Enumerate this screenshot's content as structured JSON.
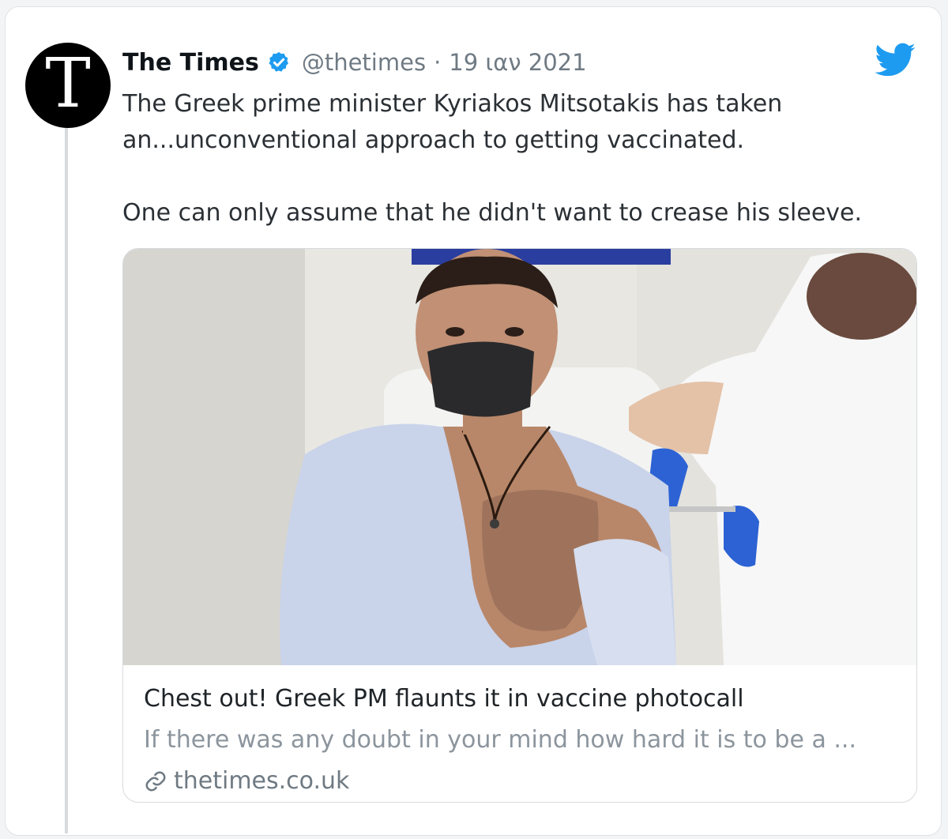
{
  "tweet": {
    "avatar_letter": "T",
    "author_name": "The Times",
    "verified_icon": "verified-badge-icon",
    "handle": "@thetimes",
    "separator": "·",
    "date": "19 ιαν 2021",
    "brand_icon": "twitter-bird-icon",
    "text_lines": [
      "The Greek prime minister Kyriakos Mitsotakis has taken",
      "an...unconventional approach to getting vaccinated.",
      "One can only assume that he didn't want to crease his sleeve."
    ]
  },
  "link_card": {
    "title": "Chest out! Greek PM flaunts it in vaccine photocall",
    "description": "If there was any doubt in your mind how hard it is to be a ...",
    "link_icon": "link-icon",
    "domain": "thetimes.co.uk"
  },
  "colors": {
    "twitter_blue": "#1d9bf0",
    "text_primary": "#0f1419",
    "text_secondary": "#6f7a83",
    "border": "#d6dadd"
  }
}
